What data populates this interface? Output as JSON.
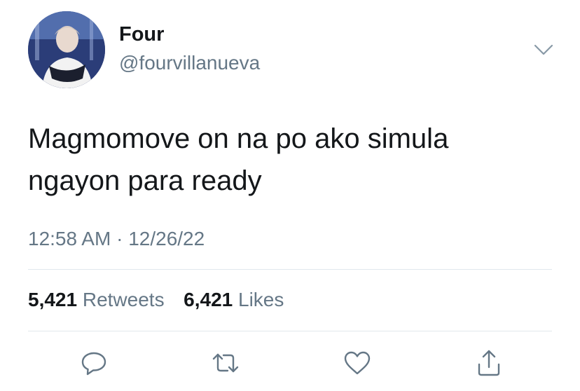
{
  "author": {
    "display_name": "Four",
    "handle": "@fourvillanueva"
  },
  "tweet": {
    "text_lines": [
      "Magmomove on na po ako simula",
      "ngayon para ready"
    ],
    "time": "12:58 AM",
    "separator": "·",
    "date": "12/26/22"
  },
  "stats": {
    "retweets_count": "5,421",
    "retweets_label": "Retweets",
    "likes_count": "6,421",
    "likes_label": "Likes"
  },
  "icons": {
    "more": "chevron-down-icon",
    "reply": "reply-icon",
    "retweet": "retweet-icon",
    "like": "heart-icon",
    "share": "share-icon"
  },
  "colors": {
    "text": "#14171a",
    "secondary": "#657786",
    "divider": "#e1e8ed"
  }
}
